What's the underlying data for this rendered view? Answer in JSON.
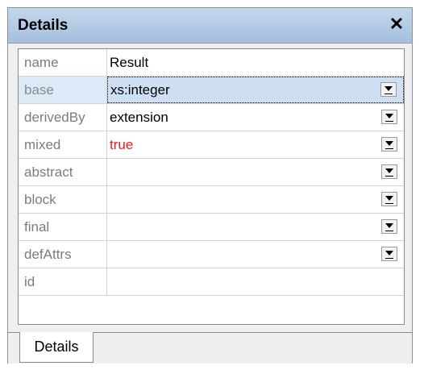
{
  "window": {
    "title": "Details",
    "close_glyph": "✕"
  },
  "properties": [
    {
      "label": "name",
      "value": "Result",
      "has_dropdown": false,
      "value_color": "#000000"
    },
    {
      "label": "base",
      "value": "xs:integer",
      "has_dropdown": true,
      "value_color": "#000000",
      "selected": true
    },
    {
      "label": "derivedBy",
      "value": "extension",
      "has_dropdown": true,
      "value_color": "#000000"
    },
    {
      "label": "mixed",
      "value": "true",
      "has_dropdown": true,
      "value_color": "#ee1c1c"
    },
    {
      "label": "abstract",
      "value": "",
      "has_dropdown": true
    },
    {
      "label": "block",
      "value": "",
      "has_dropdown": true
    },
    {
      "label": "final",
      "value": "",
      "has_dropdown": true
    },
    {
      "label": "defAttrs",
      "value": "",
      "has_dropdown": true
    },
    {
      "label": "id",
      "value": "",
      "has_dropdown": false
    }
  ],
  "tabs": [
    {
      "label": "Details",
      "active": true
    }
  ],
  "colors": {
    "titlebar": "#a4c0de",
    "selection": "#cfe0f4",
    "label_text": "#7c7c7c",
    "highlight_value": "#ee1c1c"
  }
}
